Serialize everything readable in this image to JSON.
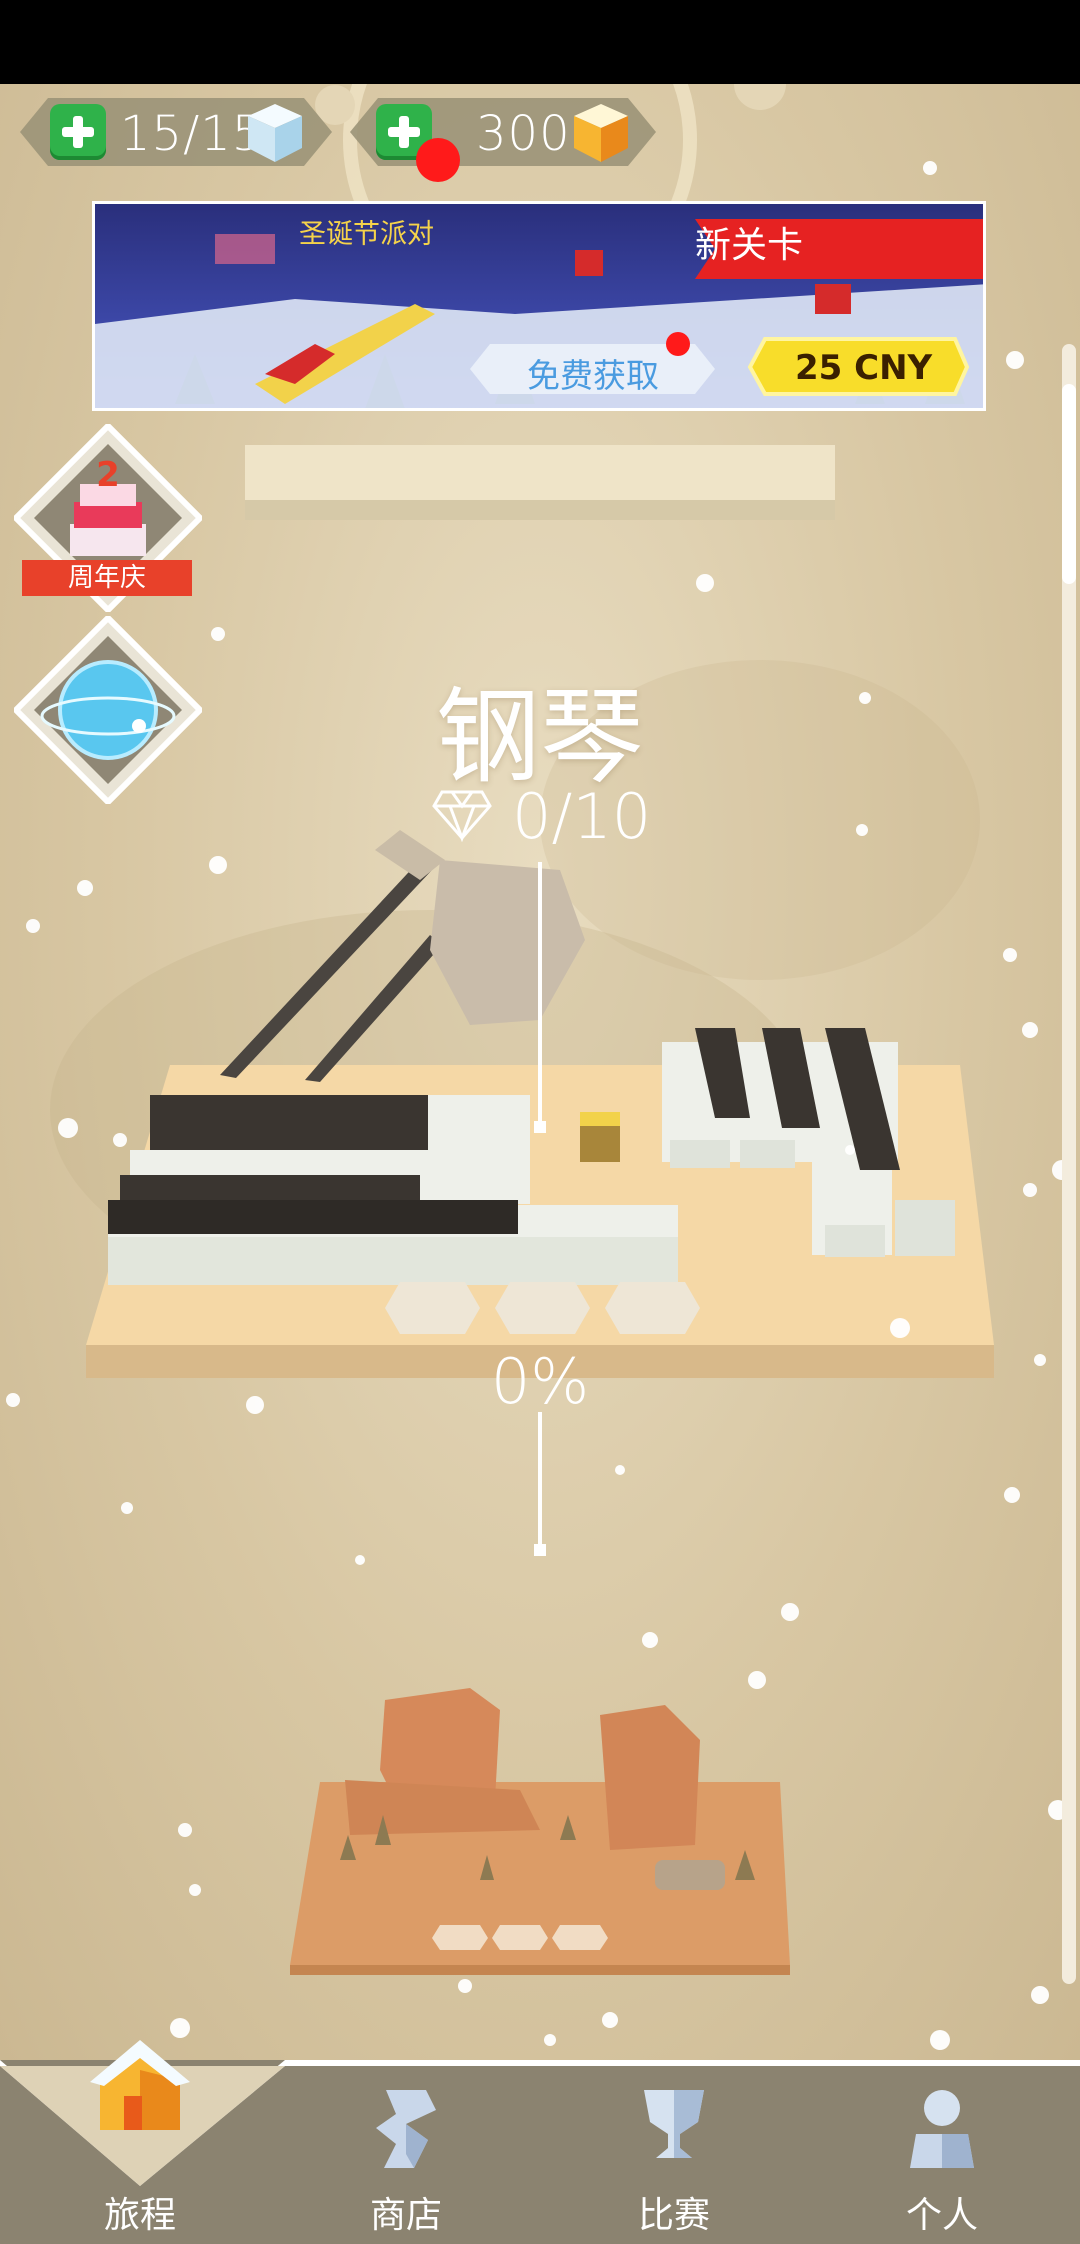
{
  "resources": {
    "cubes": {
      "value": "15/15",
      "icon": "ice-cube-icon"
    },
    "gems": {
      "value": "300",
      "icon": "gold-cube-icon",
      "has_notification": true
    }
  },
  "banner": {
    "title": "圣诞节派对",
    "tag": "新关卡",
    "free_button": "免费获取",
    "price": "25 CNY"
  },
  "side": {
    "anniversary_label": "周年庆"
  },
  "level": {
    "name": "钢琴",
    "gems_collected": "0/10",
    "progress": "0%"
  },
  "nav": {
    "items": [
      {
        "label": "旅程",
        "icon": "house-icon",
        "active": true
      },
      {
        "label": "商店",
        "icon": "shop-icon",
        "active": false
      },
      {
        "label": "比赛",
        "icon": "trophy-icon",
        "active": false
      },
      {
        "label": "个人",
        "icon": "person-icon",
        "active": false
      }
    ]
  },
  "colors": {
    "background": "#d8c7a3",
    "nav_bar": "#8b8370",
    "plus_green": "#2fb24a",
    "ribbon_red": "#e8412a",
    "price_yellow": "#f8dd2a"
  }
}
